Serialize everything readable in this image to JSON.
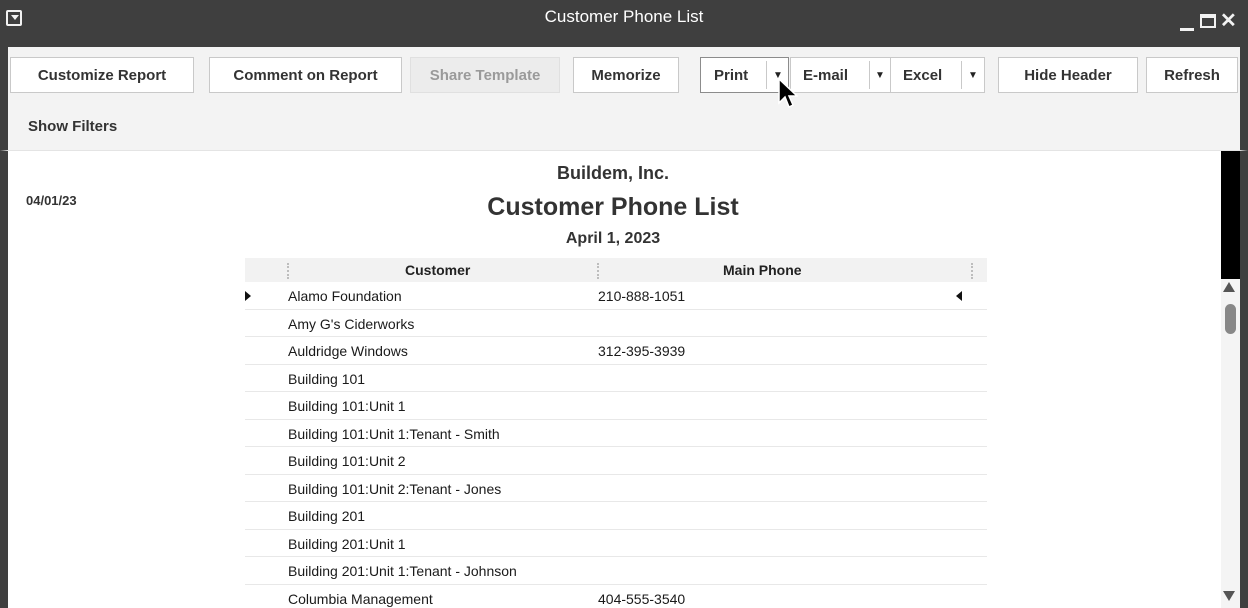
{
  "window": {
    "title": "Customer Phone List"
  },
  "toolbar": {
    "customize_report": "Customize Report",
    "comment_on_report": "Comment on Report",
    "share_template": "Share Template",
    "memorize": "Memorize",
    "print": "Print",
    "email": "E-mail",
    "excel": "Excel",
    "hide_header": "Hide Header",
    "refresh": "Refresh"
  },
  "filters": {
    "show_filters": "Show Filters"
  },
  "report": {
    "date": "04/01/23",
    "company": "Buildem, Inc.",
    "title": "Customer Phone List",
    "as_of": "April 1, 2023",
    "columns": [
      "Customer",
      "Main Phone"
    ],
    "rows": [
      {
        "customer": "Alamo Foundation",
        "phone": "210-888-1051"
      },
      {
        "customer": "Amy G's Ciderworks",
        "phone": ""
      },
      {
        "customer": "Auldridge Windows",
        "phone": "312-395-3939"
      },
      {
        "customer": "Building 101",
        "phone": ""
      },
      {
        "customer": "Building 101:Unit 1",
        "phone": ""
      },
      {
        "customer": "Building 101:Unit 1:Tenant - Smith",
        "phone": ""
      },
      {
        "customer": "Building 101:Unit 2",
        "phone": ""
      },
      {
        "customer": "Building 101:Unit 2:Tenant - Jones",
        "phone": ""
      },
      {
        "customer": "Building 201",
        "phone": ""
      },
      {
        "customer": "Building 201:Unit 1",
        "phone": ""
      },
      {
        "customer": "Building 201:Unit 1:Tenant - Johnson",
        "phone": ""
      },
      {
        "customer": "Columbia Management",
        "phone": "404-555-3540"
      }
    ]
  },
  "icons": {
    "system_menu": "system-menu-icon",
    "minimize": "minimize-icon",
    "maximize": "maximize-icon",
    "close": "close-icon",
    "dropdown": "dropdown-arrow-icon",
    "cursor": "mouse-pointer-icon"
  }
}
